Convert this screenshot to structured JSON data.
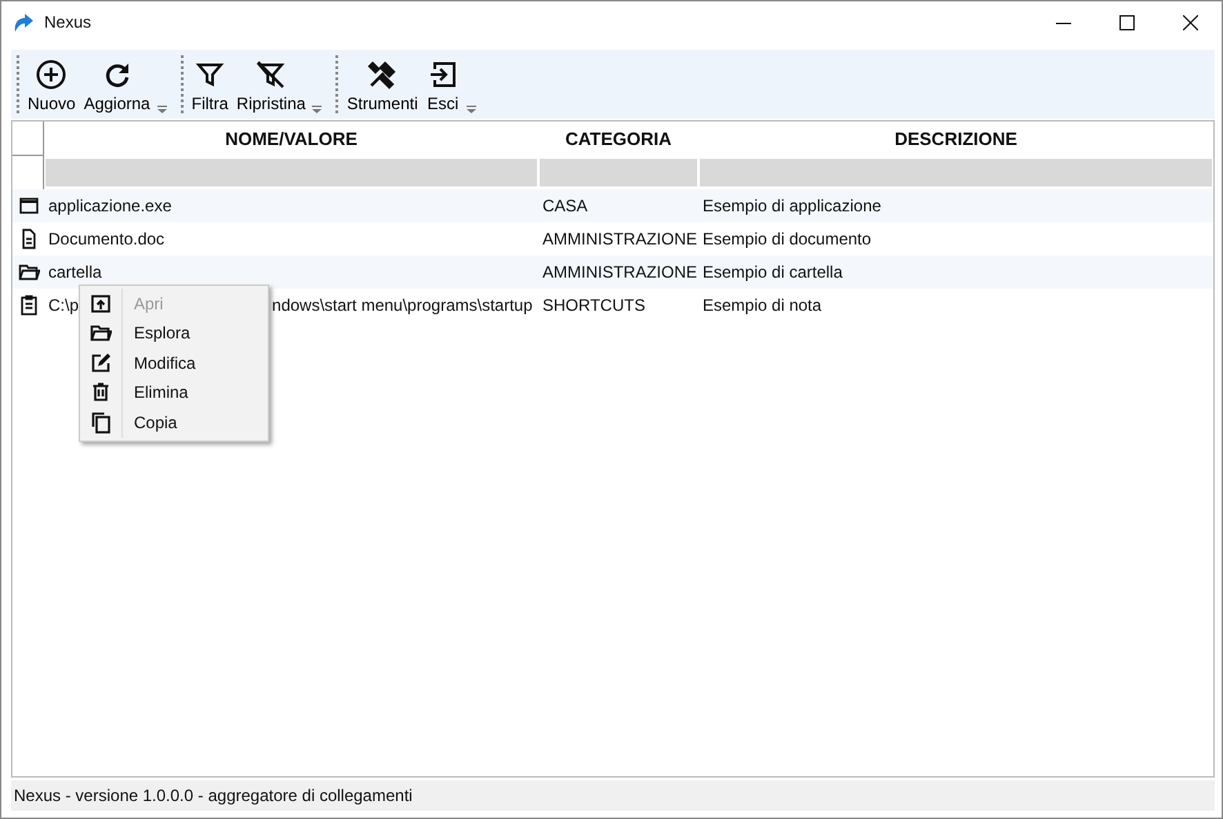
{
  "window": {
    "title": "Nexus"
  },
  "toolbar": {
    "groups": [
      {
        "buttons": [
          {
            "label": "Nuovo",
            "kind": "plus"
          },
          {
            "label": "Aggiorna",
            "kind": "refresh"
          }
        ]
      },
      {
        "buttons": [
          {
            "label": "Filtra",
            "kind": "filter"
          },
          {
            "label": "Ripristina",
            "kind": "nofilter"
          }
        ]
      },
      {
        "buttons": [
          {
            "label": "Strumenti",
            "kind": "tools"
          },
          {
            "label": "Esci",
            "kind": "exit"
          }
        ]
      }
    ]
  },
  "table": {
    "columns": [
      "NOME/VALORE",
      "CATEGORIA",
      "DESCRIZIONE"
    ],
    "rows": [
      {
        "kind": "app",
        "name_parts": [
          "applicazione.exe"
        ],
        "category": "CASA",
        "description": "Esempio di applicazione"
      },
      {
        "kind": "document",
        "name_parts": [
          "Documento.doc"
        ],
        "category": "AMMINISTRAZIONE",
        "description": "Esempio di documento"
      },
      {
        "kind": "folder",
        "name_parts": [
          "cartella"
        ],
        "category": "AMMINISTRAZIONE",
        "description": "Esempio di cartella"
      },
      {
        "kind": "note",
        "name_parts": [
          "C:\\p",
          "ndows\\start menu\\programs\\startup"
        ],
        "category": "SHORTCUTS",
        "description": "Esempio di nota"
      }
    ]
  },
  "context_menu": {
    "items": [
      {
        "label": "Apri",
        "kind": "open",
        "disabled": true
      },
      {
        "label": "Esplora",
        "kind": "folder",
        "disabled": false
      },
      {
        "label": "Modifica",
        "kind": "edit",
        "disabled": false
      },
      {
        "label": "Elimina",
        "kind": "delete",
        "disabled": false
      },
      {
        "label": "Copia",
        "kind": "copy",
        "disabled": false
      }
    ]
  },
  "status_bar": "Nexus - versione 1.0.0.0 - aggregatore di collegamenti"
}
